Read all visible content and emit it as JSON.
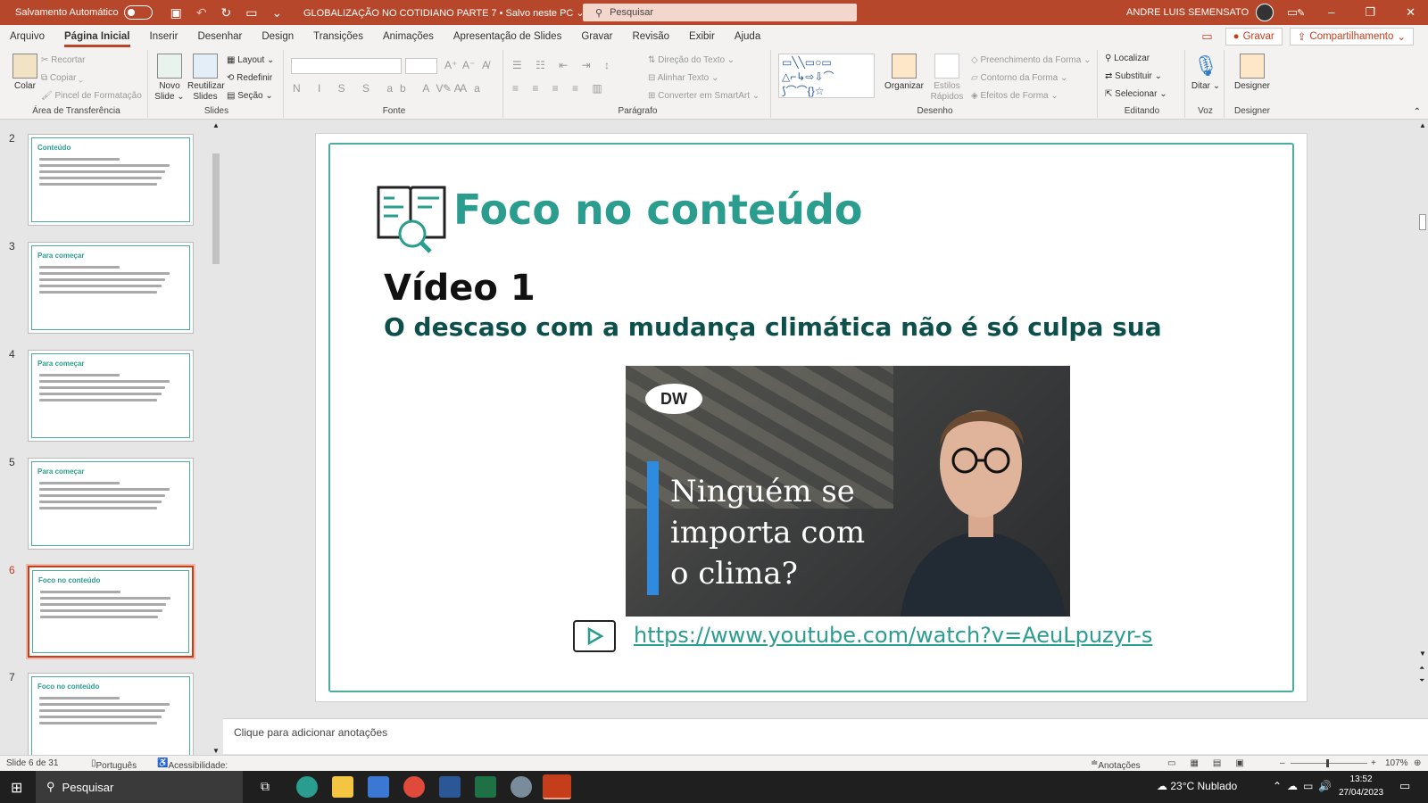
{
  "titlebar": {
    "autosave_label": "Salvamento Automático",
    "doc_title": "GLOBALIZAÇÃO NO COTIDIANO PARTE 7 • Salvo neste PC",
    "search_placeholder": "Pesquisar",
    "user_name": "ANDRE LUIS SEMENSATO"
  },
  "menu": {
    "tabs": [
      "Arquivo",
      "Página Inicial",
      "Inserir",
      "Desenhar",
      "Design",
      "Transições",
      "Animações",
      "Apresentação de Slides",
      "Gravar",
      "Revisão",
      "Exibir",
      "Ajuda"
    ],
    "active_tab": "Página Inicial",
    "record_button": "Gravar",
    "share_button": "Compartilhamento"
  },
  "ribbon": {
    "clipboard": {
      "label": "Área de Transferência",
      "paste": "Colar",
      "cut": "Recortar",
      "copy": "Copiar",
      "format_painter": "Pincel de Formatação"
    },
    "slides": {
      "label": "Slides",
      "new_slide": "Novo Slide",
      "reuse": "Reutilizar Slides",
      "layout": "Layout",
      "reset": "Redefinir",
      "section": "Seção"
    },
    "font": {
      "label": "Fonte"
    },
    "paragraph": {
      "label": "Parágrafo",
      "text_direction": "Direção do Texto",
      "align_text": "Alinhar Texto",
      "smartart": "Converter em SmartArt"
    },
    "drawing": {
      "label": "Desenho",
      "arrange": "Organizar",
      "quick_styles": "Estilos Rápidos",
      "fill": "Preenchimento da Forma",
      "outline": "Contorno da Forma",
      "effects": "Efeitos de Forma"
    },
    "editing": {
      "label": "Editando",
      "find": "Localizar",
      "replace": "Substituir",
      "select": "Selecionar"
    },
    "voice": {
      "label": "Voz",
      "dictate": "Ditar"
    },
    "designer": {
      "label": "Designer",
      "designer": "Designer"
    }
  },
  "thumbnails": [
    {
      "num": "2",
      "title": "Conteúdo"
    },
    {
      "num": "3",
      "title": "Para começar"
    },
    {
      "num": "4",
      "title": "Para começar"
    },
    {
      "num": "5",
      "title": "Para começar"
    },
    {
      "num": "6",
      "title": "Foco no conteúdo",
      "selected": true
    },
    {
      "num": "7",
      "title": "Foco no conteúdo"
    }
  ],
  "slide": {
    "title": "Foco no conteúdo",
    "video_label": "Vídeo 1",
    "video_subtitle": "O descaso com a mudança climática não é só culpa sua",
    "thumb_logo": "DW",
    "thumb_text": "Ninguém se\nimporta com\no clima?",
    "link": "https://www.youtube.com/watch?v=AeuLpuzyr-s"
  },
  "notes_placeholder": "Clique para adicionar anotações",
  "status": {
    "slide_count": "Slide 6 de 31",
    "language": "Português (Brasil)",
    "accessibility": "Acessibilidade: investigar",
    "notes_button": "Anotações",
    "zoom": "107%"
  },
  "taskbar": {
    "search": "Pesquisar",
    "weather": "23°C  Nublado",
    "time": "13:52",
    "date": "27/04/2023"
  },
  "colors": {
    "accent": "#b7472a",
    "slide_teal": "#2a9d8f",
    "dark_teal": "#0d4f4a"
  }
}
